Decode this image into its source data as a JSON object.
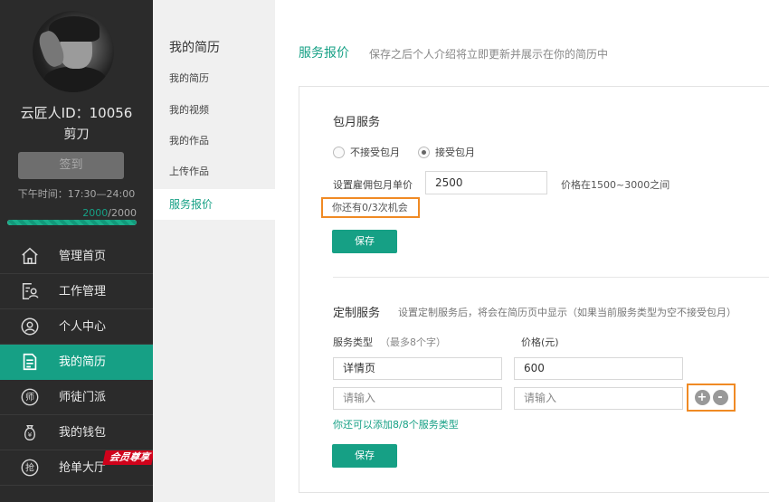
{
  "profile": {
    "user_id": "云匠人ID：10056",
    "name": "剪刀",
    "checkin_label": "签到",
    "work_time": "下午时间：17:30—24:00",
    "progress_current": "2000",
    "progress_total": "/2000",
    "progress_fraction": 1.0
  },
  "nav": {
    "items": [
      {
        "label": "管理首页",
        "icon": "home-icon"
      },
      {
        "label": "工作管理",
        "icon": "work-manage-icon"
      },
      {
        "label": "个人中心",
        "icon": "user-circle-icon"
      },
      {
        "label": "我的简历",
        "icon": "resume-icon",
        "active": true
      },
      {
        "label": "师徒门派",
        "icon": "master-icon"
      },
      {
        "label": "我的钱包",
        "icon": "wallet-icon"
      },
      {
        "label": "抢单大厅",
        "icon": "grab-order-icon"
      }
    ],
    "vip_badge": "会员尊享"
  },
  "submenu": {
    "title": "我的简历",
    "items": [
      "我的简历",
      "我的视频",
      "我的作品",
      "上传作品",
      "服务报价"
    ],
    "active_index": 4
  },
  "main": {
    "title": "服务报价",
    "description": "保存之后个人介绍将立即更新并展示在你的简历中"
  },
  "monthly": {
    "title": "包月服务",
    "options": [
      "不接受包月",
      "接受包月"
    ],
    "selected_index": 1,
    "price_label": "设置雇佣包月单价",
    "price_value": "2500",
    "price_range_hint": "价格在1500~3000之间",
    "chances_hint": "你还有0/3次机会",
    "save_label": "保存"
  },
  "custom": {
    "title": "定制服务",
    "description": "设置定制服务后，将会在简历页中显示（如果当前服务类型为空不接受包月）",
    "type_header": "服务类型",
    "type_header_note": "（最多8个字）",
    "price_header": "价格(元)",
    "rows": [
      {
        "type": "详情页",
        "price": "600"
      }
    ],
    "type_placeholder": "请输入",
    "price_placeholder": "请输入",
    "add_symbol": "+",
    "remove_symbol": "-",
    "add_hint": "你还可以添加8/8个服务类型",
    "save_label": "保存"
  },
  "colors": {
    "accent": "#16a085",
    "sidebar_bg": "#2b2b2b",
    "highlight_border": "#f08a24",
    "vip_red": "#d0021b"
  }
}
